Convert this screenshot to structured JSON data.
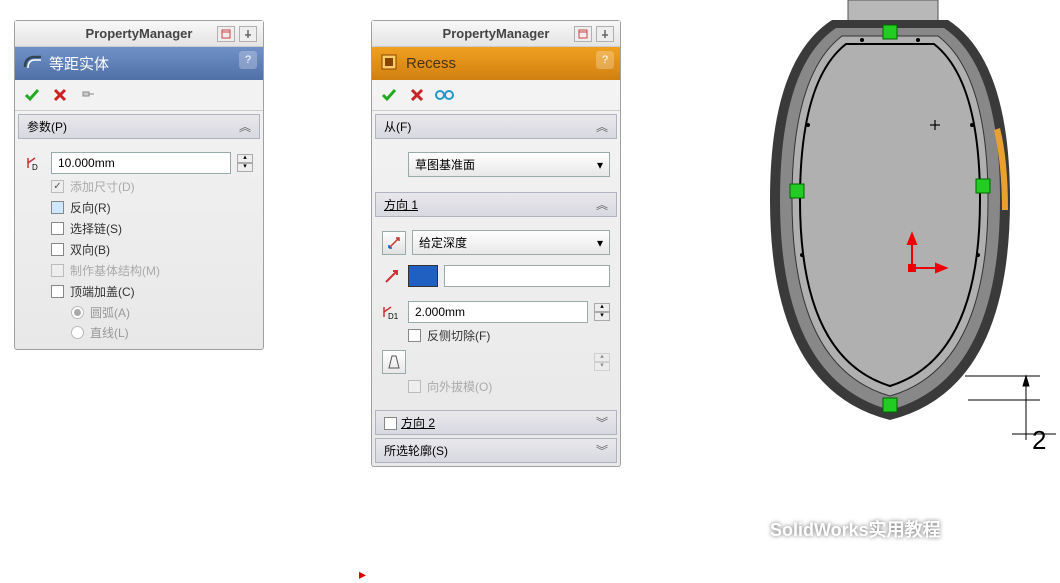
{
  "pm_title": "PropertyManager",
  "left": {
    "title": "等距实体",
    "help": "?",
    "section_params": "参数(P)",
    "distance": "10.000mm",
    "chk_add_dim": "添加尺寸(D)",
    "chk_reverse": "反向(R)",
    "chk_select_chain": "选择链(S)",
    "chk_bidir": "双向(B)",
    "chk_base": "制作基体结构(M)",
    "chk_cap": "顶端加盖(C)",
    "radio_arc": "圆弧(A)",
    "radio_line": "直线(L)"
  },
  "right": {
    "title": "Recess",
    "help": "?",
    "section_from": "从(F)",
    "from_option": "草图基准面",
    "section_dir1": "方向 1",
    "end_condition": "给定深度",
    "depth": "2.000mm",
    "chk_flip": "反侧切除(F)",
    "chk_draft": "向外拔模(O)",
    "section_dir2": "方向 2",
    "section_contour": "所选轮廓(S)"
  },
  "watermark": "SolidWorks实用教程",
  "dim": "2"
}
